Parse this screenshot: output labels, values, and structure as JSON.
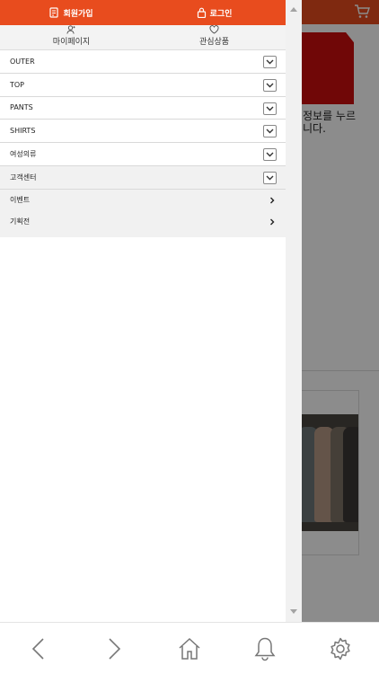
{
  "drawer": {
    "join_label": "회원가입",
    "login_label": "로그인",
    "mypage_label": "마이페이지",
    "wishlist_label": "관심상품"
  },
  "menu": {
    "categories": [
      {
        "label": "OUTER"
      },
      {
        "label": "TOP"
      },
      {
        "label": "PANTS"
      },
      {
        "label": "SHIRTS"
      },
      {
        "label": "여성의류"
      },
      {
        "label": "고객센터"
      }
    ],
    "sub_items": [
      {
        "label": "이벤트"
      },
      {
        "label": "기획전"
      }
    ]
  },
  "background": {
    "partial_text_line1": "정보를 누르",
    "partial_text_line2": "니다."
  },
  "bottom_nav": {
    "icons": [
      "back-icon",
      "forward-icon",
      "home-icon",
      "bell-icon",
      "settings-icon"
    ]
  },
  "colors": {
    "accent": "#e84c1e",
    "overlay": "rgba(0,0,0,0.45)",
    "banner_red": "#cc0d0d"
  }
}
